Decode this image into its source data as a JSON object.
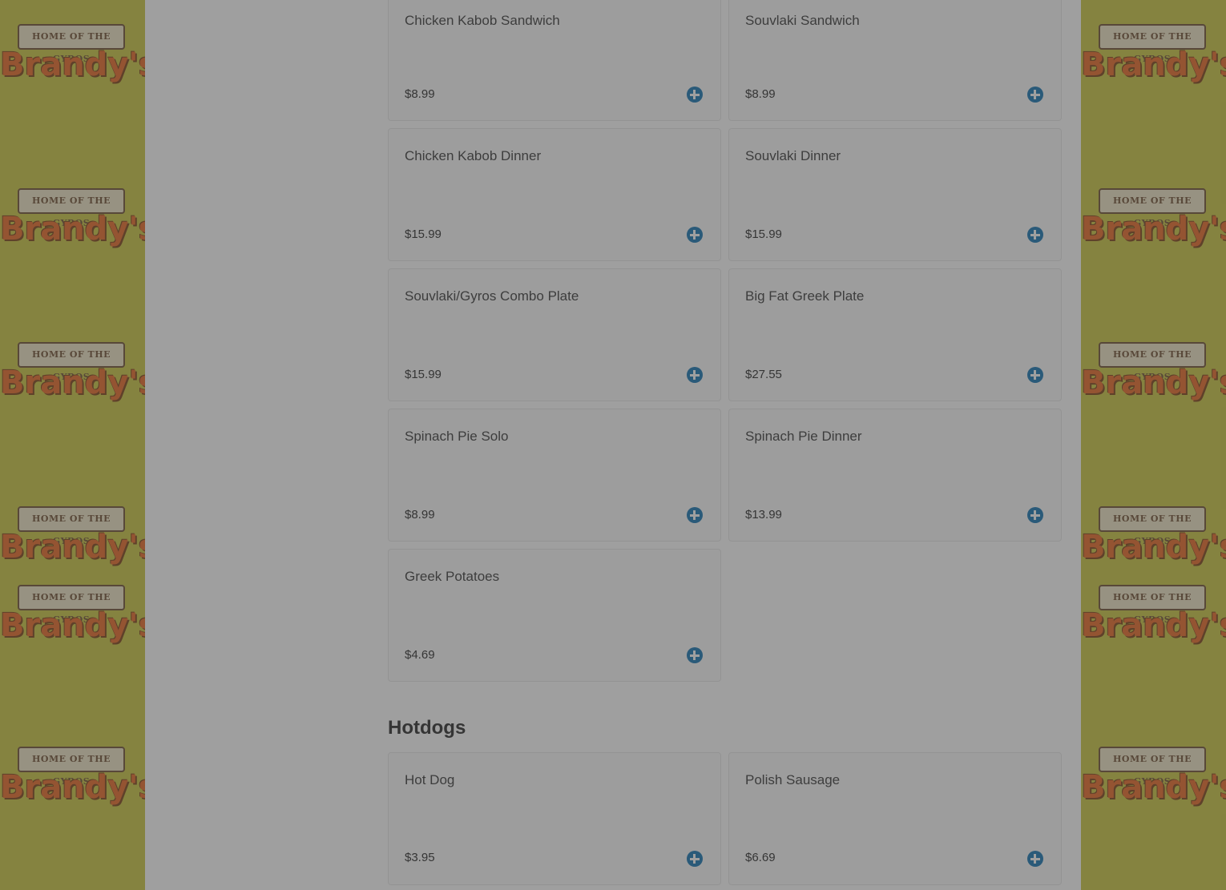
{
  "brand": {
    "banner": "HOME OF THE GYROS",
    "name": "Brandy's"
  },
  "menu": [
    {
      "name": "Chicken Kabob Sandwich",
      "price": "$8.99"
    },
    {
      "name": "Souvlaki Sandwich",
      "price": "$8.99"
    },
    {
      "name": "Chicken Kabob Dinner",
      "price": "$15.99"
    },
    {
      "name": "Souvlaki Dinner",
      "price": "$15.99"
    },
    {
      "name": "Souvlaki/Gyros Combo Plate",
      "price": "$15.99"
    },
    {
      "name": "Big Fat Greek Plate",
      "price": "$27.55"
    },
    {
      "name": "Spinach Pie Solo",
      "price": "$8.99"
    },
    {
      "name": "Spinach Pie Dinner",
      "price": "$13.99"
    },
    {
      "name": "Greek Potatoes",
      "price": "$4.69"
    }
  ],
  "hotdogs": {
    "title": "Hotdogs",
    "items": [
      {
        "name": "Hot Dog",
        "price": "$3.95"
      },
      {
        "name": "Polish Sausage",
        "price": "$6.69"
      }
    ]
  },
  "colors": {
    "accent": "#0b6fb0",
    "side_bg": "#c8c43a",
    "logo_orange": "#e8631c"
  },
  "icons": {
    "add": "plus-circle-icon"
  }
}
